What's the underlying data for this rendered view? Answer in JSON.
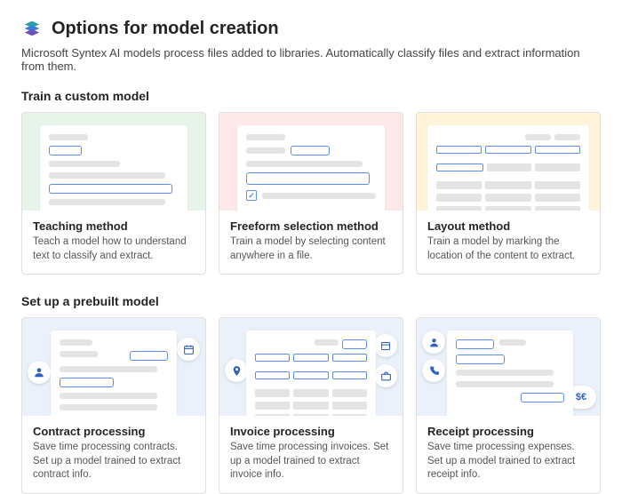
{
  "header": {
    "title": "Options for model creation",
    "subtitle": "Microsoft Syntex AI models process files added to libraries. Automatically classify files and extract information from them."
  },
  "sections": {
    "custom": {
      "title": "Train a custom model",
      "cards": [
        {
          "title": "Teaching method",
          "desc": "Teach a model how to understand text to classify and extract."
        },
        {
          "title": "Freeform selection method",
          "desc": "Train a model by selecting content anywhere in a file."
        },
        {
          "title": "Layout method",
          "desc": "Train a model by marking the location of the content to extract."
        }
      ]
    },
    "prebuilt": {
      "title": "Set up a prebuilt model",
      "cards": [
        {
          "title": "Contract processing",
          "desc": "Save time processing contracts. Set up a model trained to extract contract info."
        },
        {
          "title": "Invoice processing",
          "desc": "Save time processing invoices. Set up a model trained to extract invoice info."
        },
        {
          "title": "Receipt processing",
          "desc": "Save time processing expenses. Set up a model trained to extract receipt info."
        }
      ]
    }
  }
}
